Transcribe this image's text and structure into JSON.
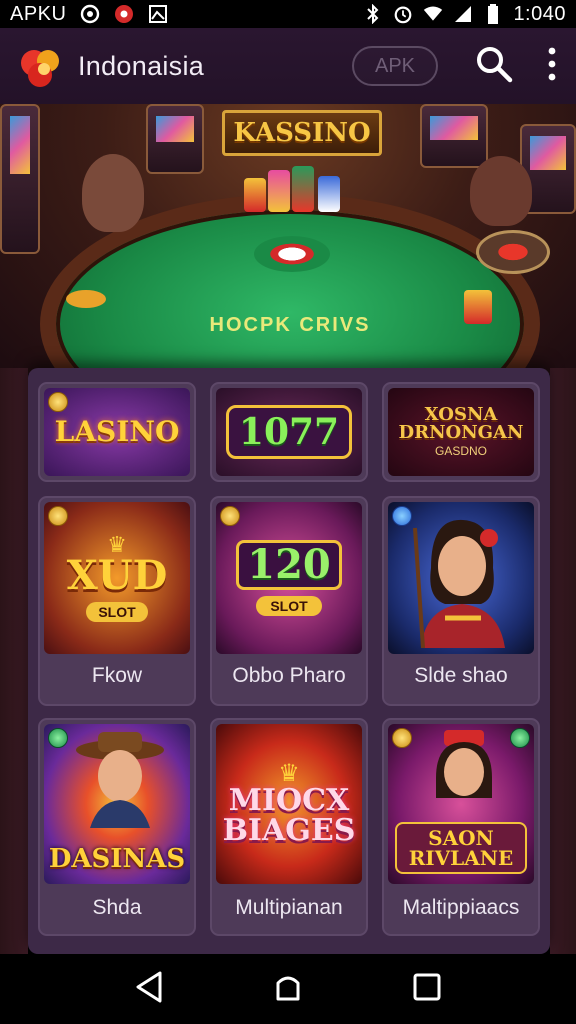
{
  "status_bar": {
    "left_text": "APKU",
    "time": "1:040",
    "icons": [
      "whatsapp-icon",
      "record-icon",
      "image-icon",
      "bluetooth-icon",
      "alarm-icon",
      "wifi-icon",
      "signal-icon",
      "battery-icon"
    ]
  },
  "app_bar": {
    "title": "Indonaisia",
    "apk_label": "APK",
    "icons": [
      "app-logo-icon",
      "search-icon",
      "more-vert-icon"
    ]
  },
  "hero": {
    "sign_text": "KASSINO",
    "table_text": "HOCPK CRIVS"
  },
  "featured_games": [
    {
      "art_title": "LASINO",
      "art_sub": ""
    },
    {
      "art_title": "1077",
      "art_sub": ""
    },
    {
      "art_title": "XOSNA DRNONGAN",
      "art_sub": "GASDNO"
    }
  ],
  "games": [
    {
      "art_title": "XUD",
      "art_sub": "SLOT",
      "label": "Fkow"
    },
    {
      "art_title": "120",
      "art_sub": "SLOT",
      "label": "Obbo Pharo"
    },
    {
      "art_title": "",
      "art_sub": "",
      "label": "Slde shao"
    },
    {
      "art_title": "DASINAS",
      "art_sub": "",
      "label": "Shda"
    },
    {
      "art_title": "MIOCX BIAGES",
      "art_sub": "",
      "label": "Multipianan"
    },
    {
      "art_title": "SAON RIVLANE",
      "art_sub": "",
      "label": "Maltippiaacs"
    }
  ],
  "nav_bar": {
    "icons": [
      "back-icon",
      "home-icon",
      "recents-icon"
    ]
  },
  "colors": {
    "panel": "#3d2947",
    "card": "#4e3a58",
    "appbar": "#2a1630",
    "gold": "#f3c23a",
    "felt": "#1a8a46"
  }
}
